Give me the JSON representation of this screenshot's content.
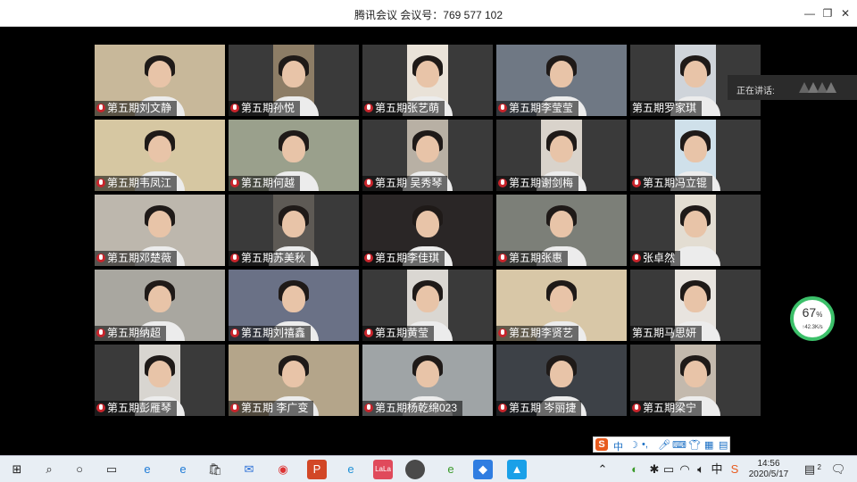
{
  "window": {
    "title": "腾讯会议 会议号：769 577 102",
    "minimize_icon": "minimize-icon",
    "restore_icon": "restore-icon",
    "close_icon": "close-icon"
  },
  "speaking": {
    "label": "正在讲话:"
  },
  "participants": [
    {
      "name": "第五期刘文静",
      "muted": true,
      "bg": "#c8b89a"
    },
    {
      "name": "第五期孙悦",
      "muted": true,
      "bg": "#8d7d66"
    },
    {
      "name": "第五期张艺萌",
      "muted": true,
      "bg": "#e9e2d8"
    },
    {
      "name": "第五期李莹莹",
      "muted": true,
      "bg": "#6f7884"
    },
    {
      "name": "第五期罗家琪",
      "muted": false,
      "bg": "#cfd4da"
    },
    {
      "name": "第五期韦凤江",
      "muted": true,
      "bg": "#d6c7a2"
    },
    {
      "name": "第五期何越",
      "muted": true,
      "bg": "#9aa08c"
    },
    {
      "name": "第五期 吴秀琴",
      "muted": true,
      "bg": "#b8b0a4"
    },
    {
      "name": "第五期谢剑梅",
      "muted": true,
      "bg": "#d9d3cb"
    },
    {
      "name": "第五期冯立锟",
      "muted": true,
      "bg": "#cfe0ea"
    },
    {
      "name": "第五期邓楚薇",
      "muted": true,
      "bg": "#bdb7ad"
    },
    {
      "name": "第五期苏美秋",
      "muted": true,
      "bg": "#5e5a55"
    },
    {
      "name": "第五期李佳琪",
      "muted": true,
      "bg": "#2a2626"
    },
    {
      "name": "第五期张惠",
      "muted": true,
      "bg": "#7c7f78"
    },
    {
      "name": "张卓然",
      "muted": true,
      "bg": "#e3ddd2"
    },
    {
      "name": "第五期纳超",
      "muted": true,
      "bg": "#a9a7a0"
    },
    {
      "name": "第五期刘禧鑫",
      "muted": true,
      "bg": "#6a7186"
    },
    {
      "name": "第五期黄莹",
      "muted": true,
      "bg": "#dad7d2"
    },
    {
      "name": "第五期李贤艺",
      "muted": true,
      "bg": "#d8c7a7"
    },
    {
      "name": "第五期马思妍",
      "muted": false,
      "bg": "#e8e4df"
    },
    {
      "name": "第五期彭雁琴",
      "muted": true,
      "bg": "#d8d5d0"
    },
    {
      "name": "第五期 李广变",
      "muted": true,
      "bg": "#b4a58a"
    },
    {
      "name": "第五期杨乾绵023",
      "muted": true,
      "bg": "#9fa4a6"
    },
    {
      "name": "第五期 岑丽捷",
      "muted": true,
      "bg": "#3d4147"
    },
    {
      "name": "第五期梁宁",
      "muted": true,
      "bg": "#c3b9ad"
    }
  ],
  "network": {
    "percent": "67",
    "percent_sign": "%",
    "speed": "↑42.3K/s",
    "ring_color": "#3cc06a"
  },
  "ime": {
    "mode": "中",
    "brand_icon": "sogou-icon"
  },
  "taskbar": {
    "start_icon": "windows-start-icon",
    "search_icon": "search-icon",
    "cortana_icon": "cortana-circle-icon",
    "taskview_icon": "task-view-icon",
    "time": "14:56",
    "date": "2020/5/17",
    "notification_count": "2"
  }
}
